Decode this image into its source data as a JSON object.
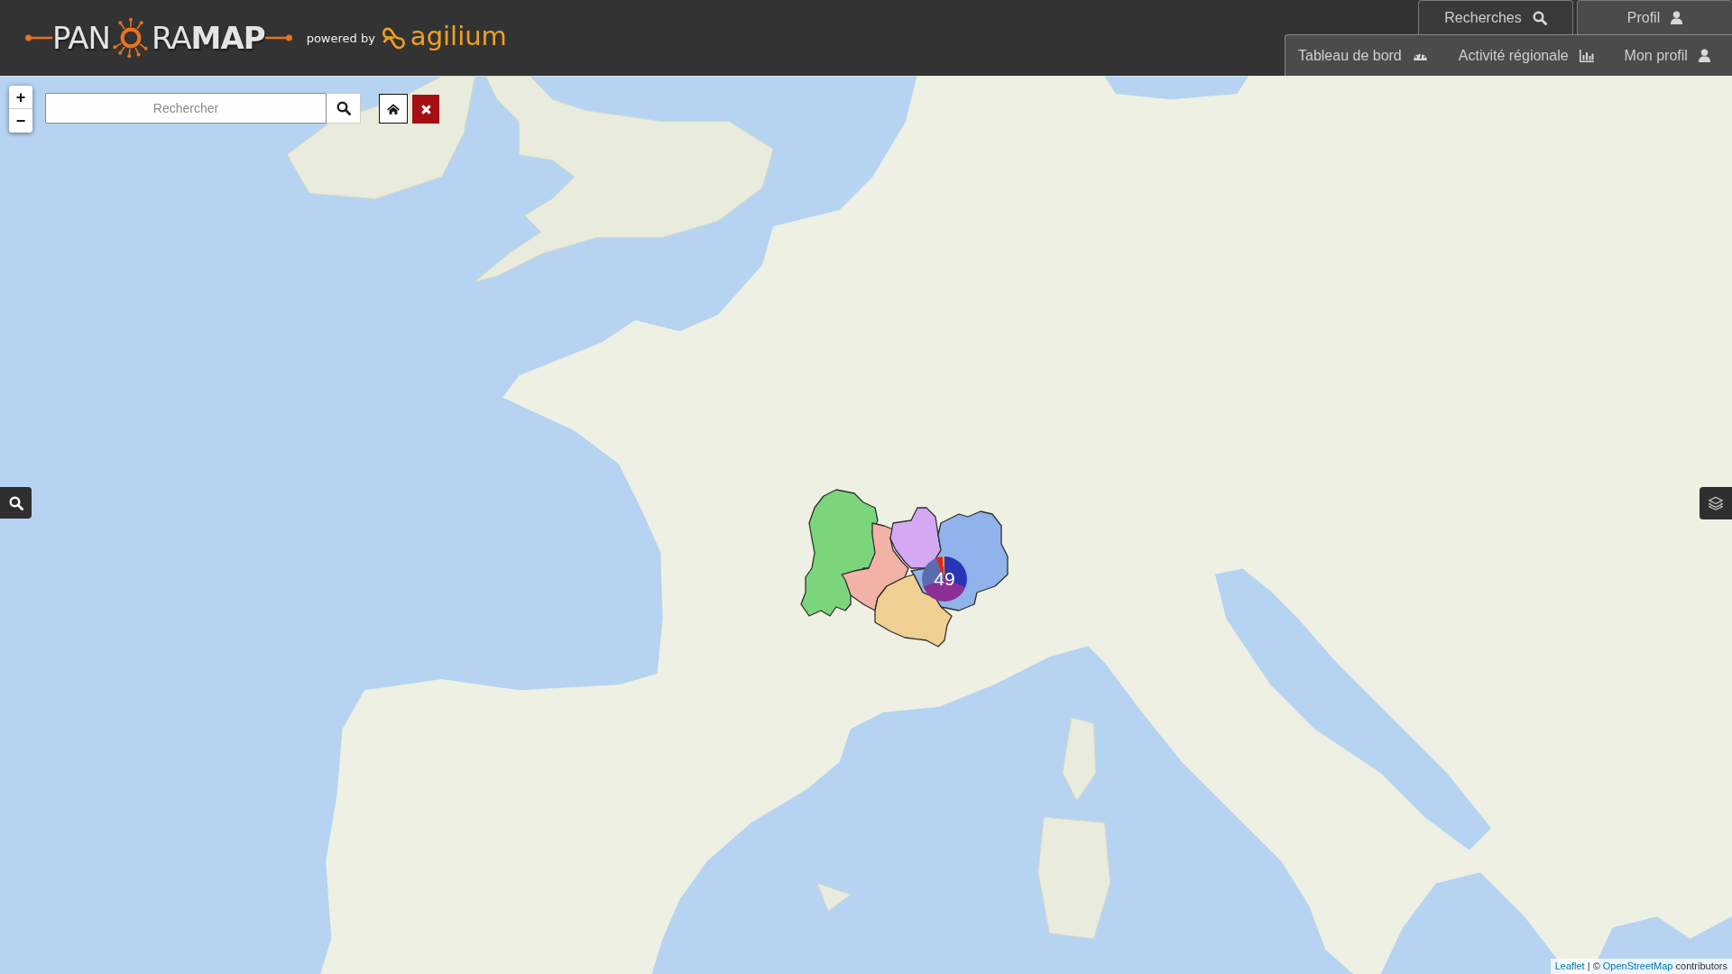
{
  "header": {
    "logo": {
      "left": "PAN",
      "right": "RA**MAP**"
    },
    "powered_by": "powered by",
    "brand": "agilium",
    "tabs": [
      {
        "label": "Recherches",
        "selected": false
      },
      {
        "label": "Profil",
        "selected": true
      }
    ],
    "submenu": [
      {
        "label": "Tableau de bord"
      },
      {
        "label": "Activité régionale"
      },
      {
        "label": "Mon profil"
      }
    ]
  },
  "map": {
    "zoom": {
      "in": "+",
      "out": "−"
    },
    "search": {
      "placeholder": "Rechercher"
    },
    "regions": [
      {
        "color": "#7bd67b"
      },
      {
        "color": "#f2b2a6"
      },
      {
        "color": "#d4a8f3"
      },
      {
        "color": "#8fb3ea"
      },
      {
        "color": "#f0cf92"
      }
    ],
    "cluster": {
      "count": "49"
    },
    "attribution": [
      {
        "text": "Leaflet",
        "kind": "link"
      },
      {
        "text": " | © ",
        "kind": "text"
      },
      {
        "text": "OpenStreetMap",
        "kind": "link"
      },
      {
        "text": " contributors",
        "kind": "text"
      }
    ]
  }
}
